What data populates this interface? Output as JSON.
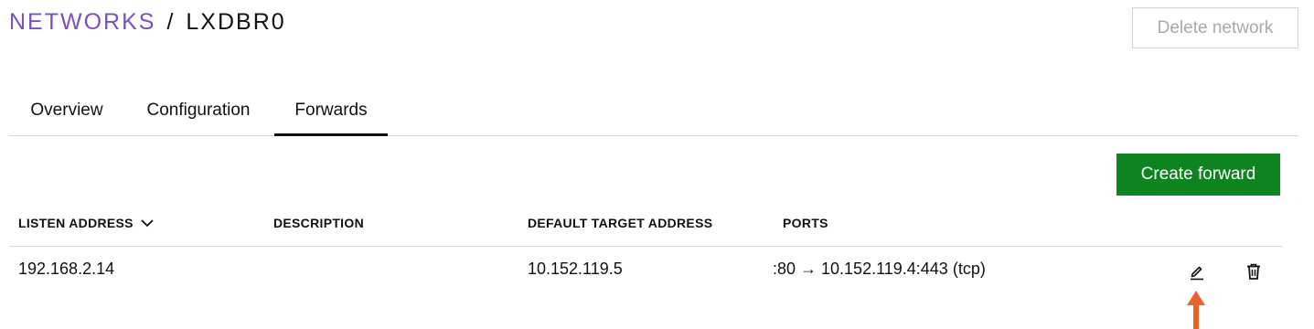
{
  "breadcrumb": {
    "parent": "NETWORKS",
    "separator": "/",
    "current": "LXDBR0"
  },
  "header": {
    "delete_label": "Delete network"
  },
  "tabs": [
    {
      "label": "Overview",
      "active": false
    },
    {
      "label": "Configuration",
      "active": false
    },
    {
      "label": "Forwards",
      "active": true
    }
  ],
  "toolbar": {
    "create_label": "Create forward"
  },
  "table": {
    "columns": [
      "LISTEN ADDRESS",
      "DESCRIPTION",
      "DEFAULT TARGET ADDRESS",
      "PORTS"
    ],
    "sort_column": "LISTEN ADDRESS",
    "rows": [
      {
        "listen_address": "192.168.2.14",
        "description": "",
        "default_target": "10.152.119.5",
        "ports": ":80 → 10.152.119.4:443 (tcp)"
      }
    ]
  },
  "icons": {
    "sort": "chevron-down-icon",
    "edit": "pencil-icon",
    "delete": "trash-icon",
    "annotation": "arrow-up-icon"
  },
  "colors": {
    "breadcrumb_link": "#7a4fbf",
    "primary_button": "#0e8420",
    "annotation_arrow": "#e8622a",
    "disabled_text": "#a8a8a8"
  }
}
